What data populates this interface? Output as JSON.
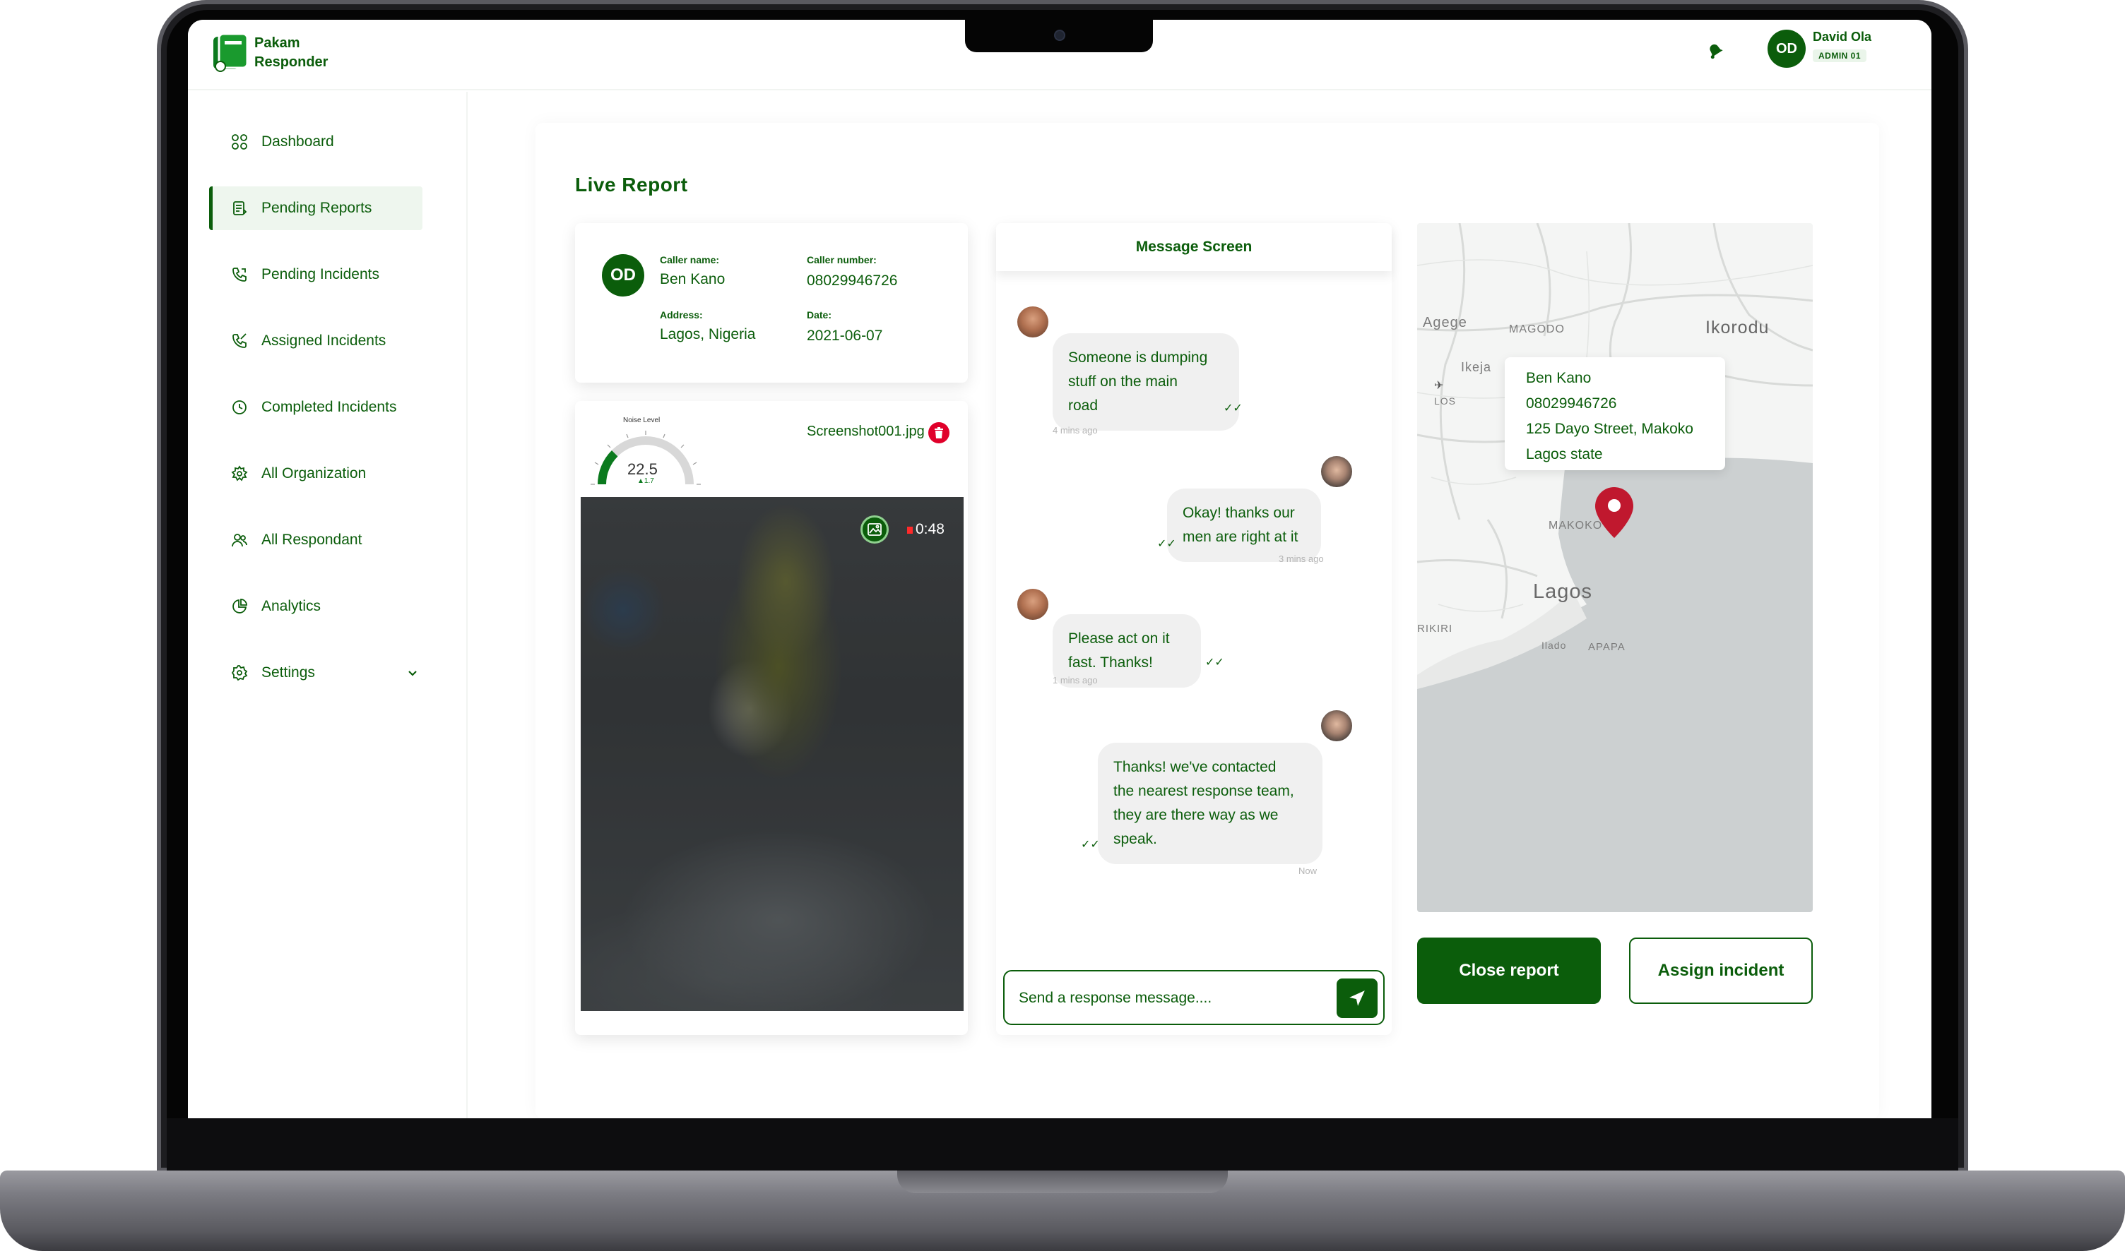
{
  "brand": {
    "name_line1": "Pakam",
    "name_line2": "Responder"
  },
  "user": {
    "initials": "OD",
    "name": "David  Ola",
    "role": "ADMIN  01"
  },
  "sidebar": {
    "items": [
      {
        "label": "Dashboard",
        "icon": "grid-icon"
      },
      {
        "label": "Pending Reports",
        "icon": "report-icon",
        "active": true
      },
      {
        "label": "Pending Incidents",
        "icon": "phone-icon"
      },
      {
        "label": "Assigned Incidents",
        "icon": "phone-check-icon"
      },
      {
        "label": "Completed Incidents",
        "icon": "clock-icon"
      },
      {
        "label": "All Organization",
        "icon": "organization-icon"
      },
      {
        "label": "All Respondant",
        "icon": "users-icon"
      },
      {
        "label": "Analytics",
        "icon": "pie-chart-icon"
      },
      {
        "label": "Settings",
        "icon": "gear-icon"
      }
    ]
  },
  "page": {
    "title": "Live Report"
  },
  "caller": {
    "initials": "OD",
    "name_label": "Caller name:",
    "name": "Ben Kano",
    "number_label": "Caller number:",
    "number": "08029946726",
    "address_label": "Address:",
    "address": "Lagos, Nigeria",
    "date_label": "Date:",
    "date": "2021-06-07"
  },
  "media": {
    "noise_label": "Noise Level",
    "noise_value": "22.5",
    "noise_delta": "▲1.7",
    "noise_level_fraction": 0.25,
    "file_name": "Screenshot001.jpg",
    "record_time": "0:48"
  },
  "messages": {
    "header": "Message Screen",
    "items": [
      {
        "side": "left",
        "lines": [
          "Someone is dumping",
          "stuff on the main",
          "road"
        ],
        "time": "4 mins ago"
      },
      {
        "side": "right",
        "lines": [
          "Okay! thanks our",
          "men are right at it"
        ],
        "time": "3 mins ago"
      },
      {
        "side": "left",
        "lines": [
          "Please act on it",
          "fast. Thanks!"
        ],
        "time": "1 mins ago"
      },
      {
        "side": "right",
        "lines": [
          "Thanks! we've contacted",
          "the nearest response team,",
          "they are there way as we",
          "speak."
        ],
        "time": "Now"
      }
    ],
    "input_placeholder": "Send a response message...."
  },
  "map": {
    "labels": {
      "agege": "Agege",
      "magodo": "MAGODO",
      "ikorodu": "Ikorodu",
      "ikeja": "Ikeja",
      "los": "LOS",
      "makoko": "MAKOKO",
      "lagos": "Lagos",
      "rikiri": "RIKIRI",
      "apapa": "APAPA",
      "ilado": "Ilado"
    },
    "tooltip": {
      "name": "Ben Kano",
      "phone": "08029946726",
      "street": "125 Dayo Street, Makoko",
      "state": "Lagos state"
    }
  },
  "actions": {
    "close": "Close report",
    "assign": "Assign incident"
  },
  "colors": {
    "primary": "#0B5D0B",
    "danger": "#E0002A",
    "pin": "#C0182E"
  }
}
